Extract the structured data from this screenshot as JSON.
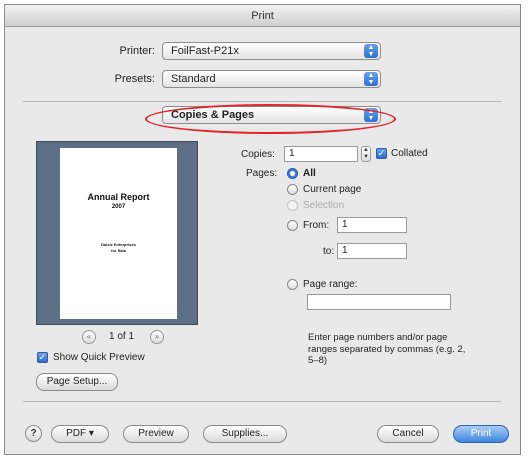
{
  "window": {
    "title": "Print"
  },
  "printer": {
    "label": "Printer:",
    "value": "FoilFast-P21x"
  },
  "presets": {
    "label": "Presets:",
    "value": "Standard"
  },
  "section": {
    "value": "Copies & Pages"
  },
  "preview": {
    "page_title": "Annual Report",
    "page_year": "2007",
    "page_footer_line1": "Dalsiz Enterprises",
    "page_footer_line2": "for Sala",
    "page_indicator": "1 of 1",
    "prev_glyph": "«",
    "next_glyph": "»"
  },
  "quick_preview": {
    "label": "Show Quick Preview",
    "checked": true
  },
  "page_setup_label": "Page Setup...",
  "copies": {
    "label": "Copies:",
    "value": "1",
    "collated_label": "Collated",
    "collated_checked": true
  },
  "pages": {
    "label": "Pages:",
    "all_label": "All",
    "current_label": "Current page",
    "selection_label": "Selection",
    "from_label": "From:",
    "from_value": "1",
    "to_label": "to:",
    "to_value": "1",
    "range_label": "Page range:",
    "range_value": "",
    "hint": "Enter page numbers and/or page ranges separated by commas (e.g. 2, 5–8)"
  },
  "buttons": {
    "help": "?",
    "pdf": "PDF ▾",
    "preview": "Preview",
    "supplies": "Supplies...",
    "cancel": "Cancel",
    "print": "Print"
  },
  "colors": {
    "accent": "#3f86de",
    "highlight_ring": "#e4232b"
  }
}
